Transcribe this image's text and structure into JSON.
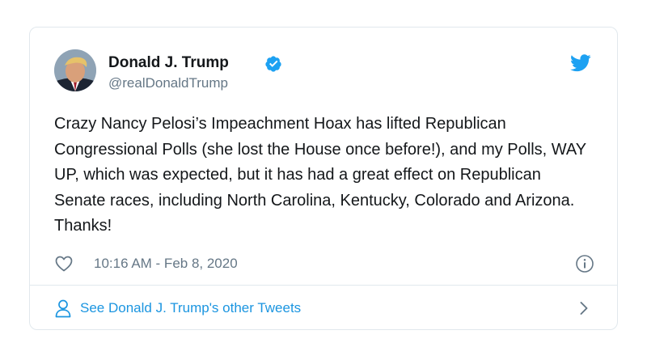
{
  "tweet": {
    "author": {
      "display_name": "Donald J. Trump",
      "handle": "@realDonaldTrump",
      "verified": true,
      "avatar_icon": "profile-photo"
    },
    "brand_icon": "twitter-bird-icon",
    "text": "Crazy Nancy Pelosi’s Impeachment Hoax has lifted Republican Congressional Polls (she lost the House once before!), and my Polls, WAY UP, which was expected, but it has had a great effect on Republican Senate races, including North Carolina, Kentucky, Colorado and Arizona. Thanks!",
    "timestamp": "10:16 AM - Feb 8, 2020",
    "footer_link": "See Donald J. Trump's other Tweets"
  },
  "colors": {
    "text": "#14171a",
    "secondary": "#657786",
    "accent": "#1da1f2",
    "link": "#1b95e0",
    "border": "#e1e8ed"
  }
}
